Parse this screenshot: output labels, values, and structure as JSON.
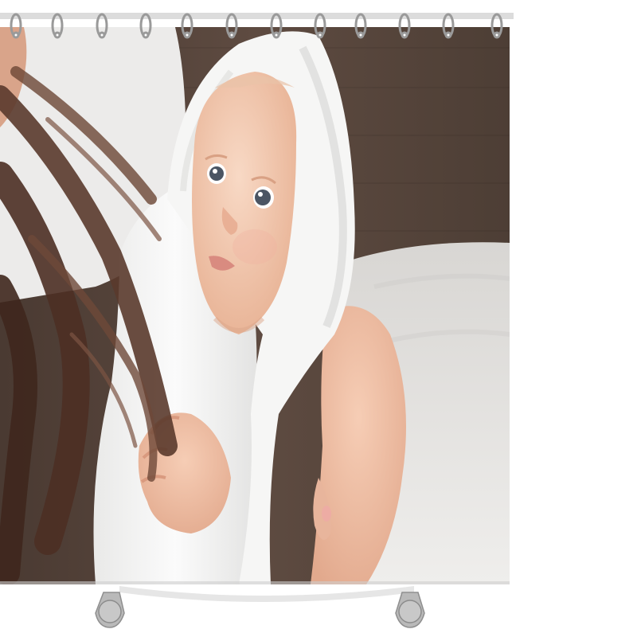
{
  "scene": {
    "subject": "shower-curtain-product",
    "print_subject": "mother-holding-baby-in-white-hooded-towel",
    "ring_count": 12,
    "colors": {
      "page_background": "#ffffff",
      "curtain_rod": "#d9d9d9",
      "ring_metal": "#9a9a9a",
      "wall": "#5b4a41",
      "bedding": "#e6e5e3",
      "towel": "#f7f7f6",
      "skin": "#efc3aa",
      "hair": "#5a3a2c",
      "eyes": "#4b5563"
    }
  }
}
